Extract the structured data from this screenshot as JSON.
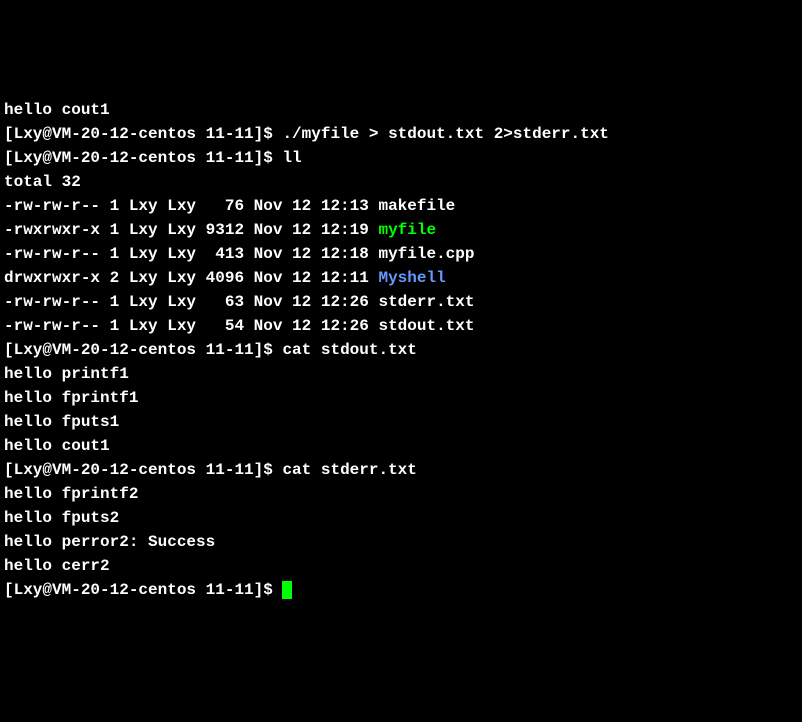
{
  "prompt": {
    "user": "Lxy",
    "host": "VM-20-12-centos",
    "cwd": "11-11",
    "full": "[Lxy@VM-20-12-centos 11-11]$ "
  },
  "lines": [
    {
      "type": "output",
      "text": "hello cout1"
    },
    {
      "type": "cmd",
      "text": "./myfile > stdout.txt 2>stderr.txt"
    },
    {
      "type": "cmd",
      "text": "ll"
    },
    {
      "type": "output",
      "text": "total 32"
    },
    {
      "type": "ls",
      "perm": "-rw-rw-r--",
      "links": "1",
      "owner": "Lxy",
      "group": "Lxy",
      "size": "  76",
      "date": "Nov 12 12:13",
      "name": "makefile",
      "color": ""
    },
    {
      "type": "ls",
      "perm": "-rwxrwxr-x",
      "links": "1",
      "owner": "Lxy",
      "group": "Lxy",
      "size": "9312",
      "date": "Nov 12 12:19",
      "name": "myfile",
      "color": "exec"
    },
    {
      "type": "ls",
      "perm": "-rw-rw-r--",
      "links": "1",
      "owner": "Lxy",
      "group": "Lxy",
      "size": " 413",
      "date": "Nov 12 12:18",
      "name": "myfile.cpp",
      "color": ""
    },
    {
      "type": "ls",
      "perm": "drwxrwxr-x",
      "links": "2",
      "owner": "Lxy",
      "group": "Lxy",
      "size": "4096",
      "date": "Nov 12 12:11",
      "name": "Myshell",
      "color": "dir"
    },
    {
      "type": "ls",
      "perm": "-rw-rw-r--",
      "links": "1",
      "owner": "Lxy",
      "group": "Lxy",
      "size": "  63",
      "date": "Nov 12 12:26",
      "name": "stderr.txt",
      "color": ""
    },
    {
      "type": "ls",
      "perm": "-rw-rw-r--",
      "links": "1",
      "owner": "Lxy",
      "group": "Lxy",
      "size": "  54",
      "date": "Nov 12 12:26",
      "name": "stdout.txt",
      "color": ""
    },
    {
      "type": "cmd",
      "text": "cat stdout.txt"
    },
    {
      "type": "output",
      "text": "hello printf1"
    },
    {
      "type": "output",
      "text": "hello fprintf1"
    },
    {
      "type": "output",
      "text": "hello fputs1"
    },
    {
      "type": "output",
      "text": "hello cout1"
    },
    {
      "type": "cmd",
      "text": "cat stderr.txt"
    },
    {
      "type": "output",
      "text": "hello fprintf2"
    },
    {
      "type": "output",
      "text": "hello fputs2"
    },
    {
      "type": "output",
      "text": "hello perror2: Success"
    },
    {
      "type": "output",
      "text": "hello cerr2"
    },
    {
      "type": "prompt-cursor"
    }
  ]
}
